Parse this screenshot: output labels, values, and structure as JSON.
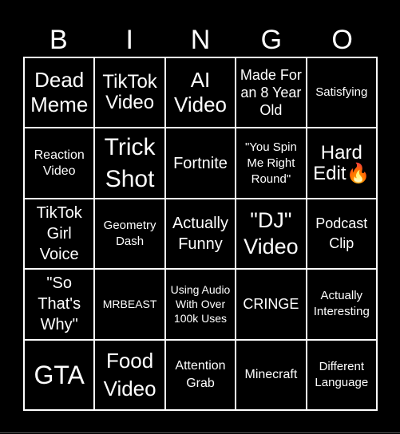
{
  "header": {
    "letters": [
      "B",
      "I",
      "N",
      "G",
      "O"
    ]
  },
  "colors": {
    "background": "#000000",
    "grid_lines": "#ffffff",
    "text": "#ffffff"
  },
  "board": {
    "rows": [
      [
        {
          "text": "Dead Meme"
        },
        {
          "text": "TikTok Video"
        },
        {
          "text": "AI Video"
        },
        {
          "text": "Made For an 8 Year Old"
        },
        {
          "text": "Satisfying"
        }
      ],
      [
        {
          "text": "Reaction Video"
        },
        {
          "text": "Trick Shot"
        },
        {
          "text": "Fortnite"
        },
        {
          "text": "\"You Spin Me Right Round\""
        },
        {
          "text": "Hard Edit🔥",
          "icon": "fire-emoji"
        }
      ],
      [
        {
          "text": "TikTok Girl Voice"
        },
        {
          "text": "Geometry Dash"
        },
        {
          "text": "Actually Funny"
        },
        {
          "text": "\"DJ\" Video"
        },
        {
          "text": "Podcast Clip"
        }
      ],
      [
        {
          "text": "\"So That's Why\""
        },
        {
          "text": "MRBEAST"
        },
        {
          "text": "Using Audio With Over 100k Uses"
        },
        {
          "text": "CRINGE"
        },
        {
          "text": "Actually Interesting"
        }
      ],
      [
        {
          "text": "GTA"
        },
        {
          "text": "Food Video"
        },
        {
          "text": "Attention Grab"
        },
        {
          "text": "Minecraft"
        },
        {
          "text": "Different Language"
        }
      ]
    ]
  }
}
